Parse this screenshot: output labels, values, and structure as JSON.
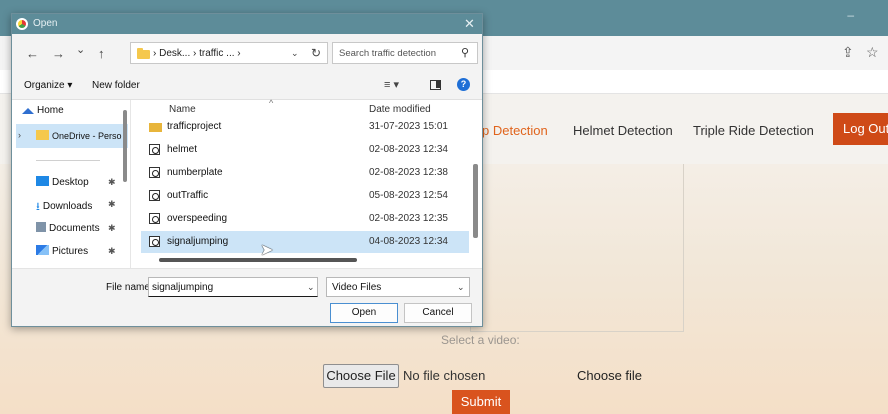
{
  "browser": {
    "window_controls": {
      "minimize": "–",
      "maximize": "□"
    },
    "toolbar_icons": [
      "share-icon",
      "star-icon"
    ]
  },
  "webpage": {
    "nav": {
      "links": [
        "p Detection",
        "Helmet Detection",
        "Triple Ride Detection"
      ],
      "logout_label": "Log Out"
    },
    "select_label": "Select a video:",
    "choose_file_button": "Choose File",
    "no_file_text": "No file chosen",
    "choose_file_label": "Choose file",
    "submit_label": "Submit",
    "colors": {
      "accent": "#e0641c",
      "button_bg": "#cf4a17"
    }
  },
  "dialog": {
    "title": "Open",
    "close_glyph": "✕",
    "nav_glyphs": {
      "back": "←",
      "forward": "→",
      "recent": "⌄",
      "up": "↑"
    },
    "breadcrumb": "› Desk... › traffic ... ›",
    "address_chevron": "⌄",
    "refresh_glyph": "↻",
    "search_placeholder": "Search traffic detection",
    "search_glyph": "⚲",
    "organize_label": "Organize ▾",
    "new_folder_label": "New folder",
    "view_glyph": "≡ ▾",
    "help_glyph": "?",
    "nav_pane": {
      "items": [
        {
          "label": "Home",
          "icon": "home-icon"
        },
        {
          "label": "OneDrive - Perso",
          "icon": "folder-icon"
        },
        {
          "label": "Desktop",
          "icon": "desktop-icon"
        },
        {
          "label": "Downloads",
          "icon": "download-icon"
        },
        {
          "label": "Documents",
          "icon": "documents-icon"
        },
        {
          "label": "Pictures",
          "icon": "pictures-icon"
        }
      ],
      "pin_glyph": "✱",
      "expand_glyph": "›"
    },
    "columns": {
      "name": "Name",
      "date": "Date modified",
      "sort_glyph": "^"
    },
    "files": [
      {
        "name": "trafficproject",
        "date": "31-07-2023 15:01",
        "type": "folder"
      },
      {
        "name": "helmet",
        "date": "02-08-2023 12:34",
        "type": "video"
      },
      {
        "name": "numberplate",
        "date": "02-08-2023 12:38",
        "type": "video"
      },
      {
        "name": "outTraffic",
        "date": "05-08-2023 12:54",
        "type": "video"
      },
      {
        "name": "overspeeding",
        "date": "02-08-2023 12:35",
        "type": "video"
      },
      {
        "name": "signaljumping",
        "date": "04-08-2023 12:34",
        "type": "video",
        "selected": true
      }
    ],
    "file_name_label": "File name:",
    "file_name_value": "signaljumping",
    "file_type_value": "Video Files",
    "open_label": "Open",
    "cancel_label": "Cancel"
  }
}
